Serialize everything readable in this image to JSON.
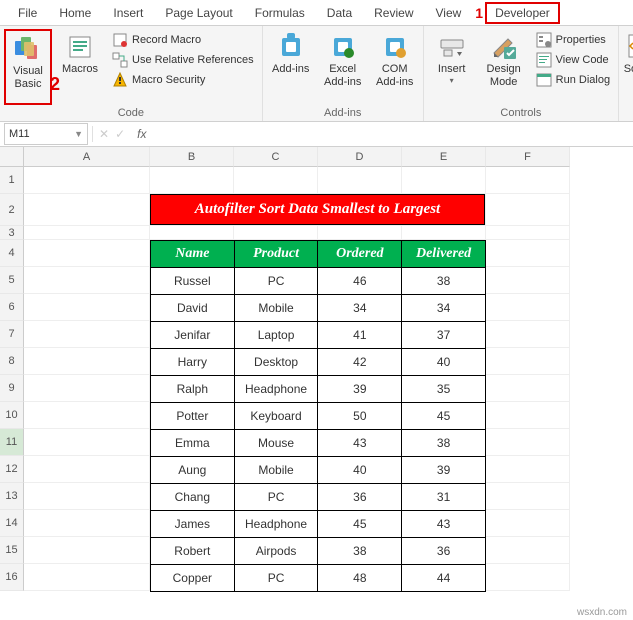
{
  "tabs": [
    "File",
    "Home",
    "Insert",
    "Page Layout",
    "Formulas",
    "Data",
    "Review",
    "View",
    "Developer"
  ],
  "highlighted_tab": "Developer",
  "annotation_tab": "1",
  "annotation_vb": "2",
  "ribbon": {
    "code": {
      "visual_basic": "Visual Basic",
      "macros": "Macros",
      "record_macro": "Record Macro",
      "use_relative": "Use Relative References",
      "macro_security": "Macro Security",
      "label": "Code"
    },
    "addins": {
      "addins": "Add-ins",
      "excel_addins": "Excel Add-ins",
      "com_addins": "COM Add-ins",
      "label": "Add-ins"
    },
    "controls": {
      "insert": "Insert",
      "design_mode": "Design Mode",
      "properties": "Properties",
      "view_code": "View Code",
      "run_dialog": "Run Dialog",
      "label": "Controls"
    },
    "xml": {
      "source": "Sourc"
    }
  },
  "name_box": "M11",
  "columns": [
    "A",
    "B",
    "C",
    "D",
    "E",
    "F"
  ],
  "rows": [
    "1",
    "2",
    "3",
    "4",
    "5",
    "6",
    "7",
    "8",
    "9",
    "10",
    "11",
    "12",
    "13",
    "14",
    "15",
    "16"
  ],
  "title": "Autofilter Sort Data Smallest to Largest",
  "table": {
    "headers": [
      "Name",
      "Product",
      "Ordered",
      "Delivered"
    ],
    "rows": [
      [
        "Russel",
        "PC",
        "46",
        "38"
      ],
      [
        "David",
        "Mobile",
        "34",
        "34"
      ],
      [
        "Jenifar",
        "Laptop",
        "41",
        "37"
      ],
      [
        "Harry",
        "Desktop",
        "42",
        "40"
      ],
      [
        "Ralph",
        "Headphone",
        "39",
        "35"
      ],
      [
        "Potter",
        "Keyboard",
        "50",
        "45"
      ],
      [
        "Emma",
        "Mouse",
        "43",
        "38"
      ],
      [
        "Aung",
        "Mobile",
        "40",
        "39"
      ],
      [
        "Chang",
        "PC",
        "36",
        "31"
      ],
      [
        "James",
        "Headphone",
        "45",
        "43"
      ],
      [
        "Robert",
        "Airpods",
        "38",
        "36"
      ],
      [
        "Copper",
        "PC",
        "48",
        "44"
      ]
    ]
  },
  "watermark": "wsxdn.com"
}
